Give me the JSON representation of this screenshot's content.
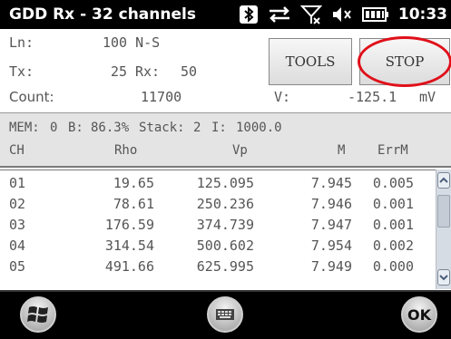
{
  "status": {
    "title": "GDD Rx - 32 channels",
    "time": "10:33",
    "icons": [
      "bluetooth-icon",
      "data-sync-icon",
      "no-signal-icon",
      "volume-icon",
      "battery-icon"
    ]
  },
  "form": {
    "ln_label": "Ln:",
    "ln_value": "100 N-S",
    "tx_label": "Tx:",
    "tx_value": "25",
    "rx_label": "Rx:",
    "rx_value": "50",
    "count_label": "Count:",
    "count_value": "11700",
    "v_label": "V:",
    "v_value": "-125.1",
    "v_unit": "mV"
  },
  "buttons": {
    "tools": "TOOLS",
    "stop": "STOP"
  },
  "info": {
    "mem_label": "MEM:",
    "mem_value": "0",
    "b_label": "B:",
    "b_value": "86.3%",
    "stack_label": "Stack:",
    "stack_value": "2",
    "i_label": "I:",
    "i_value": "1000.0"
  },
  "table": {
    "headers": [
      "CH",
      "Rho",
      "Vp",
      "M",
      "ErrM"
    ],
    "rows": [
      [
        "01",
        "19.65",
        "125.095",
        "7.945",
        "0.005"
      ],
      [
        "02",
        "78.61",
        "250.236",
        "7.946",
        "0.001"
      ],
      [
        "03",
        "176.59",
        "374.739",
        "7.947",
        "0.001"
      ],
      [
        "04",
        "314.54",
        "500.602",
        "7.954",
        "0.002"
      ],
      [
        "05",
        "491.66",
        "625.995",
        "7.949",
        "0.000"
      ]
    ]
  },
  "taskbar": {
    "ok_label": "OK"
  },
  "colors": {
    "accent_ring": "#e0101a",
    "bar_bg": "#000000",
    "band_bg": "#e4e4e4"
  }
}
